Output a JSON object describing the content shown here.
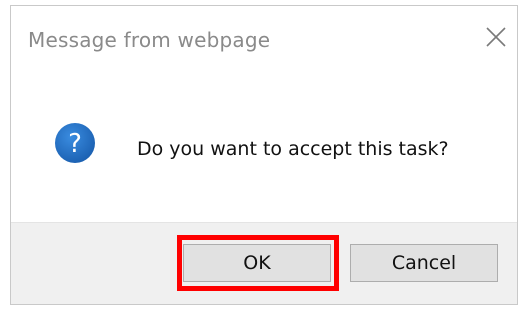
{
  "dialog": {
    "title": "Message from webpage",
    "message": "Do you want to accept this task?",
    "icon": "question-icon",
    "buttons": {
      "ok_label": "OK",
      "cancel_label": "Cancel"
    }
  },
  "colors": {
    "highlight": "#ff0000",
    "icon_blue": "#1f6fc4",
    "footer_bg": "#f0f0f0",
    "title_text": "#8a8a8a"
  }
}
